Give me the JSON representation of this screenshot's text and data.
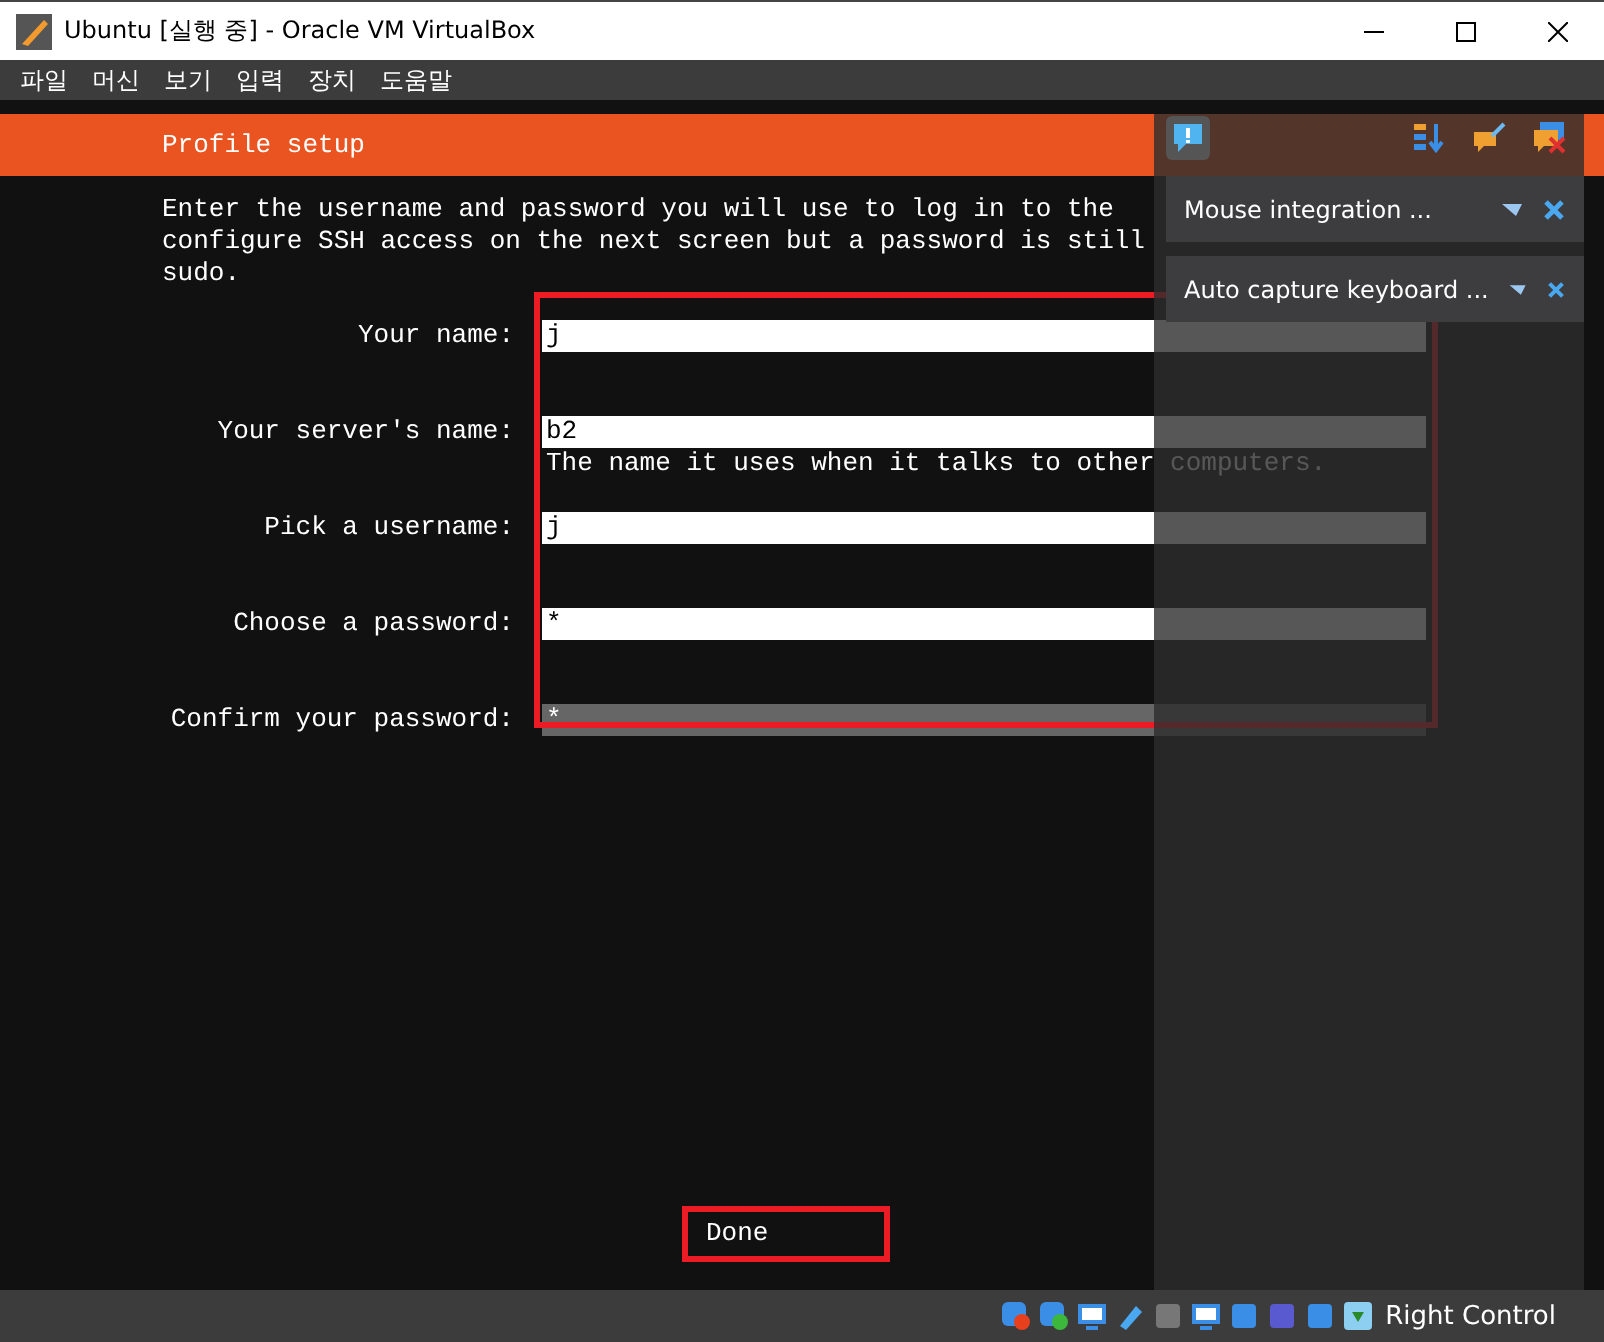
{
  "window": {
    "title": "Ubuntu [실행 중] - Oracle VM VirtualBox"
  },
  "menu": [
    "파일",
    "머신",
    "보기",
    "입력",
    "장치",
    "도움말"
  ],
  "installer": {
    "header": "Profile setup",
    "intro": [
      "Enter the username and password you will use to log in to the",
      "configure SSH access on the next screen but a password is still",
      "sudo."
    ],
    "fields": [
      {
        "label": "Your name:",
        "value": "j",
        "focused": false
      },
      {
        "label": "Your server's name:",
        "value": "b2",
        "hint": "The name it uses when it talks to other computers.",
        "focused": false
      },
      {
        "label": "Pick a username:",
        "value": "j",
        "focused": false
      },
      {
        "label": "Choose a password:",
        "value": "*",
        "focused": false
      },
      {
        "label": "Confirm your password:",
        "value": "*",
        "focused": true
      }
    ],
    "done_button": "Done"
  },
  "notifications": [
    {
      "text": "Mouse integration ..."
    },
    {
      "text": "Auto capture keyboard ..."
    }
  ],
  "status_bar": {
    "host_key": "Right Control"
  }
}
